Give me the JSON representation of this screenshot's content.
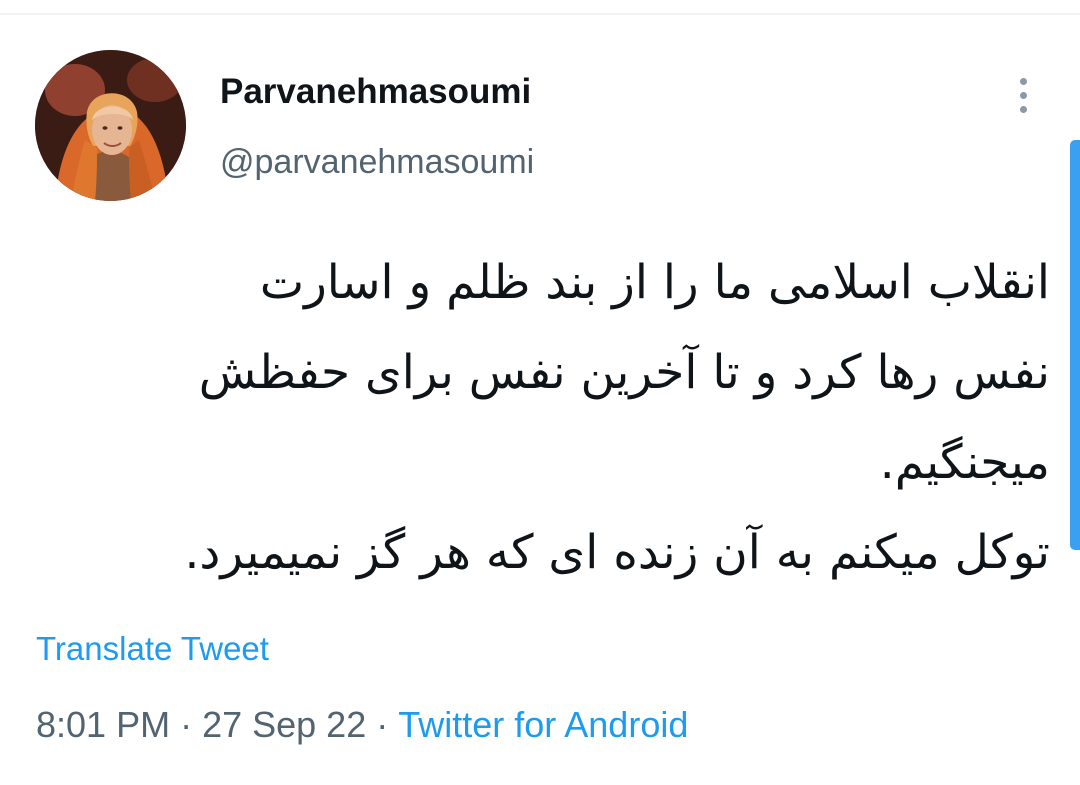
{
  "tweet": {
    "author": {
      "display_name": "Parvanehmasoumi",
      "handle": "@parvanehmasoumi",
      "avatar_icon": "profile-photo"
    },
    "more_icon": "more-vertical-icon",
    "text_lines": [
      "انقلاب اسلامی ما را از بند ظلم و اسارت",
      "نفس رها کرد و تا آخرین نفس برای حفظش",
      "میجنگیم.",
      "توکل میکنم به آن زنده ای که هر گز نمیمیرد."
    ],
    "translate_label": "Translate Tweet",
    "time": "8:01 PM",
    "separator": "·",
    "date": "27 Sep 22",
    "source": "Twitter for Android"
  },
  "colors": {
    "text": "#0f1419",
    "secondary": "#536471",
    "link": "#1d9bf0",
    "scroll": "#3aa0f2"
  }
}
